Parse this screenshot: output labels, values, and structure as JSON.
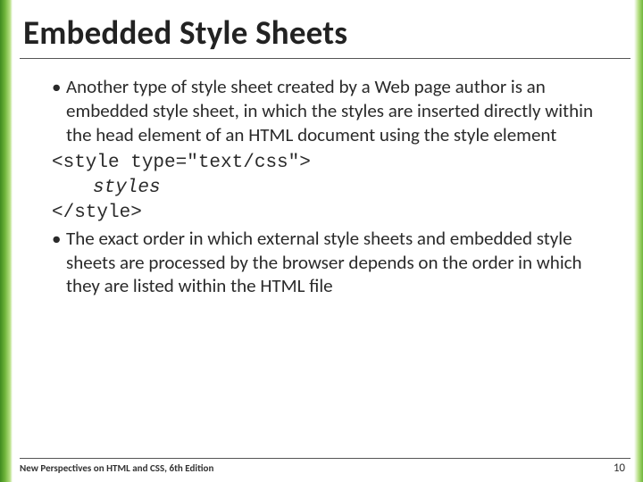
{
  "slide": {
    "title": "Embedded Style Sheets",
    "bullet1": "Another type of style sheet created by a Web page author is an embedded style sheet, in which the styles are inserted directly within the head element of an HTML document using the style element",
    "code_open": "<style type=\"text/css\">",
    "code_body": "styles",
    "code_close": "</style>",
    "bullet2": "The exact order in which external style sheets and embedded style sheets are processed by the browser depends on the order in which they are listed within the HTML file"
  },
  "footer": {
    "book": "New Perspectives on HTML and CSS, 6th Edition",
    "page": "10"
  },
  "colors": {
    "accent_green": "#6fb53b"
  }
}
